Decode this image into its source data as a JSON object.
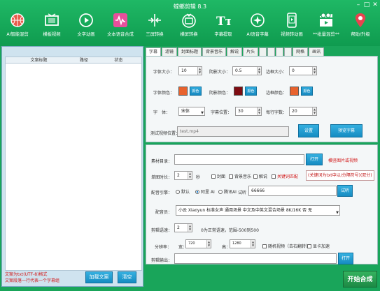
{
  "title": "螳螂剪辑 8.3",
  "window": {
    "min": "–",
    "max": "□",
    "close": "✕"
  },
  "toolbar": [
    {
      "label": "AI智能混剪",
      "icon": "basketball-icon",
      "color": "#e85a4a"
    },
    {
      "label": "横板视频",
      "icon": "film-frame-icon",
      "color": "#ffffff"
    },
    {
      "label": "文字动画",
      "icon": "play-circle-icon",
      "color": "#ffffff"
    },
    {
      "label": "文本语音合成",
      "icon": "waveform-icon",
      "color": "#ffffff"
    },
    {
      "label": "三屏转换",
      "icon": "split-arrows-icon",
      "color": "#ffffff"
    },
    {
      "label": "横屏转换",
      "icon": "tv-icon",
      "color": "#ffffff"
    },
    {
      "label": "字幕提取",
      "icon": "text-tt-icon",
      "color": "#ffffff"
    },
    {
      "label": "AI语音字幕",
      "icon": "sparkle-circle-icon",
      "color": "#ffffff"
    },
    {
      "label": "视频转动画",
      "icon": "phone-video-icon",
      "color": "#ffffff"
    },
    {
      "label": "**批量混剪**",
      "icon": "clapboard-icon",
      "color": "#ffffff"
    },
    {
      "label": "帮助/升级",
      "icon": "location-pin-icon",
      "color": "#e8434f"
    }
  ],
  "left": {
    "headers": [
      "文案标题",
      "路径",
      "状态"
    ],
    "notes": [
      "文案为txt(UTF-8)格式",
      "文案段落一行代表一个字幕组"
    ],
    "load_btn": "加载文案",
    "clear_btn": "清空"
  },
  "tabs": [
    "字幕",
    "滤镜",
    "封面标题",
    "背景音乐",
    "解说",
    "片头",
    "",
    "",
    "",
    "",
    "网格",
    "画讯"
  ],
  "style": {
    "font_size_label": "字体大小：",
    "font_size": "10",
    "shadow_size_label": "阴影大小：",
    "shadow_size": "0.5",
    "border_size_label": "边框大小：",
    "border_size": "0",
    "font_color_label": "字体颜色：",
    "font_color": "#e8622d",
    "shadow_color_label": "阴影颜色：",
    "shadow_color": "#7e0c12",
    "border_color_label": "边框颜色：",
    "border_color": "#e8622d",
    "color_btn": "颜色",
    "font_label": "字　体：",
    "font": "宋体",
    "sub_pos_label": "字幕位置：",
    "sub_pos": "30",
    "chars_label": "每行字数：",
    "chars": "20",
    "test_label": "测试视频位置：",
    "test_path": "test.mp4",
    "set_btn": "设置",
    "preview_btn": "预览字幕"
  },
  "compose": {
    "material_label": "素材目录：",
    "open_btn": "打开",
    "material_hint": "横竖图片或视频",
    "duration_label": "单图时长：",
    "duration": "2",
    "seconds": "秒",
    "opt_cover": "封面",
    "opt_bgm": "背景音乐",
    "opt_narration": "解说",
    "opt_keyword": "关键词匹配",
    "keyword_note": "(关键词为txt中以/分隔符号)(双分)",
    "dub_label": "配音引擎：",
    "dub_default": "默认",
    "dub_ali": "阿里 AI",
    "dub_tencent": "腾讯AI",
    "test_label": "试听",
    "test_text": "66666",
    "test_btn": "试听",
    "voice_label": "配音员：",
    "voice": "小云 Xiaoyun 标准女声 通用场景 中文及中英文混合场景 8K/16K 否 无",
    "rate_label": "剪辑语速：",
    "rate": "2",
    "rate_note": "0为正常语速，范围-500到500",
    "res_label": "分辨率：",
    "width_label": "宽：",
    "width": "720",
    "height_label": "高：",
    "height": "1280",
    "opt_random": "随机视频（去右翻转）",
    "opt_gpu": "显卡加速",
    "output_label": "剪辑输出：",
    "output_btn": "打开"
  },
  "synth_btn": "开始合成"
}
